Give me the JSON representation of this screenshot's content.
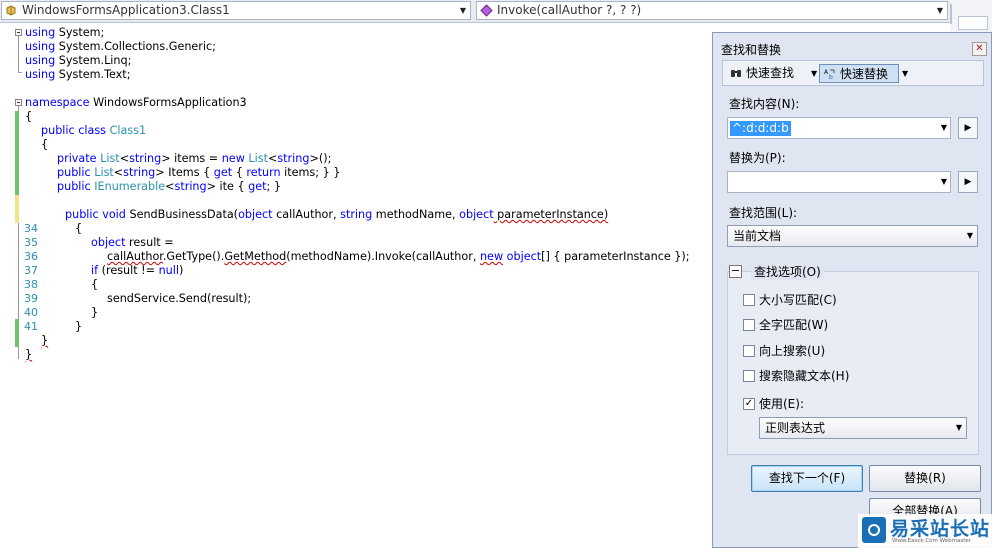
{
  "navbar": {
    "class_combo": "WindowsFormsApplication3.Class1",
    "member_combo": "Invoke(callAuthor ?, ? ?)"
  },
  "code": {
    "line1_kw": "using",
    "line1_rest": " System;",
    "line2_kw": "using",
    "line2_rest": " System.Collections.Generic;",
    "line3_kw": "using",
    "line3_rest": " System.Linq;",
    "line4_kw": "using",
    "line4_rest": " System.Text;",
    "ns_kw": "namespace",
    "ns_name": " WindowsFormsApplication3",
    "brace_open": "{",
    "brace_close": "}",
    "class_kw": "public class",
    "class_name": "Class1",
    "l1_a": "private",
    "l1_b": "List",
    "l1_c": "<",
    "l1_d": "string",
    "l1_e": "> items = ",
    "l1_f": "new",
    "l1_g": "List",
    "l1_h": "<",
    "l1_i": "string",
    "l1_j": ">();",
    "l2_a": "public",
    "l2_b": "List",
    "l2_c": "<",
    "l2_d": "string",
    "l2_e": "> Items { ",
    "l2_f": "get",
    "l2_g": " { ",
    "l2_h": "return",
    "l2_i": " items; } }",
    "l3_a": "public",
    "l3_b": "IEnumerable",
    "l3_c": "<",
    "l3_d": "string",
    "l3_e": "> ite { ",
    "l3_f": "get",
    "l3_g": "; }",
    "m_a": "public void",
    "m_b": " SendBusinessData(",
    "m_c": "object",
    "m_d": " callAuthor, ",
    "m_e": "string",
    "m_f": " methodName, ",
    "m_g": "object",
    "m_h": " parameterInstance)",
    "n34": "34",
    "n35": "35",
    "n36": "36",
    "n37": "37",
    "n38": "38",
    "n39": "39",
    "n40": "40",
    "n41": "41",
    "c35_a": "object",
    "c35_b": " result =",
    "c36_a": "callAuthor",
    "c36_b": ".GetType().",
    "c36_c": "GetMethod",
    "c36_d": "(methodName)",
    "c36_e": ".Invoke(callAuthor, ",
    "c36_f": "new",
    "c36_g": " ",
    "c36_h": "object",
    "c36_i": "[] { parameterInstance });",
    "c37_a": "if",
    "c37_b": " (result != ",
    "c37_c": "null",
    "c37_d": ")",
    "c39": "sendService.Send(result);"
  },
  "dialog": {
    "title": "查找和替换",
    "close": "✕",
    "quick_find": "快速查找",
    "quick_replace": "快速替换",
    "find_label": "查找内容(N):",
    "find_value": "^:d:d:d:b",
    "replace_label": "替换为(P):",
    "replace_value": "",
    "scope_label": "查找范围(L):",
    "scope_value": "当前文档",
    "options_label": "查找选项(O)",
    "opt_case": "大小写匹配(C)",
    "opt_whole": "全字匹配(W)",
    "opt_up": "向上搜索(U)",
    "opt_hidden": "搜索隐藏文本(H)",
    "opt_use": "使用(E):",
    "opt_use_check": "✓",
    "use_type": "正则表达式",
    "btn_find_next": "查找下一个(F)",
    "btn_replace": "替换(R)",
    "btn_replace_all": "全部替换(A)",
    "collapse": "−",
    "dropdown_arrow": "▼",
    "go_arrow": "▶"
  },
  "watermark": {
    "title": "易采站长站",
    "sub": "Www.Easck.Com Webmaster"
  }
}
